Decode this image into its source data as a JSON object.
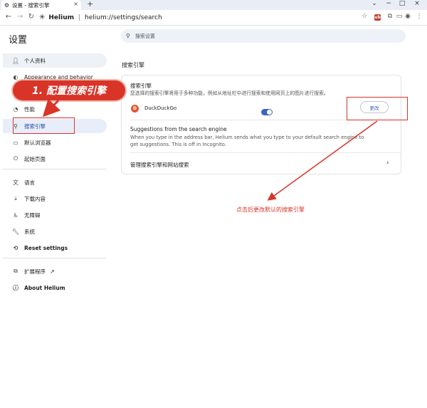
{
  "tab": {
    "title": "设置 - 搜索引擎",
    "close": "×",
    "new_tab": "+"
  },
  "window_controls": {
    "minimize": "−",
    "maximize": "□",
    "close": "×"
  },
  "address_bar": {
    "site_name": "Helium",
    "separator": "|",
    "url": "helium://settings/search"
  },
  "toolbar_icons": {
    "ublock_label": "ub"
  },
  "page": {
    "title": "设置",
    "search_placeholder": "搜索设置"
  },
  "sidebar": {
    "items": [
      {
        "label": "个人资料",
        "icon": "person-icon"
      },
      {
        "label": "Appearance and behavior",
        "icon": "palette-icon"
      },
      {
        "label": "性能",
        "icon": "gauge-icon"
      },
      {
        "label": "搜索引擎",
        "icon": "search-icon"
      },
      {
        "label": "默认浏览器",
        "icon": "browser-icon"
      },
      {
        "label": "起始页面",
        "icon": "power-icon"
      },
      {
        "label": "语言",
        "icon": "translate-icon"
      },
      {
        "label": "下载内容",
        "icon": "download-icon"
      },
      {
        "label": "无障碍",
        "icon": "accessibility-icon"
      },
      {
        "label": "系统",
        "icon": "wrench-icon"
      },
      {
        "label": "Reset settings",
        "icon": "reset-icon"
      },
      {
        "label": "扩展程序",
        "icon": "puzzle-icon"
      },
      {
        "label": "About Helium",
        "icon": "info-icon"
      }
    ]
  },
  "main": {
    "section_title": "搜索引擎",
    "search_engine": {
      "title": "搜索引擎",
      "description": "您选择的搜索引擎将用于多种功能，例如从地址栏中进行搜索和使用网页上的图片进行搜索。",
      "engine_name": "DuckDuckGo",
      "change_label": "更改"
    },
    "suggestions": {
      "title": "Suggestions from the search engine",
      "description": "When you type in the address bar, Helium sends what you type to your default search engine to get suggestions. This is off in Incognito.",
      "enabled": true
    },
    "manage_label": "管理搜索引擎和网站搜索"
  },
  "annotations": {
    "step_label": "1. 配置搜索引擎",
    "note": "点击后更改默认的搜索引擎",
    "color": "#d93428"
  }
}
